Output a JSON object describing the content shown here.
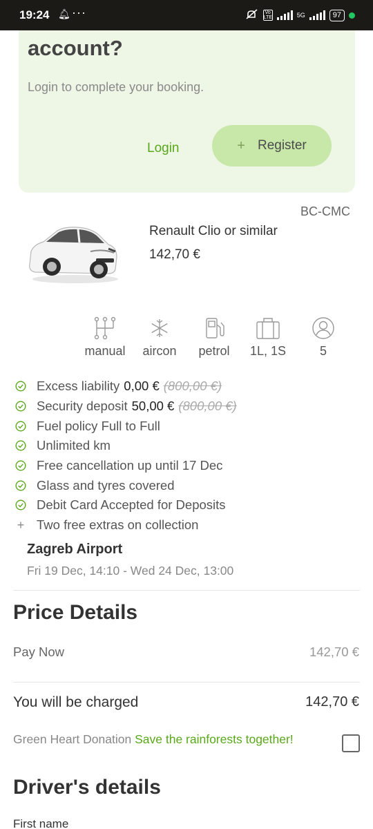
{
  "status_bar": {
    "time": "19:24",
    "network_labels": [
      "Vo LTE",
      "5G"
    ],
    "battery": "97",
    "icons": [
      "bell-icon",
      "more-icon",
      "mute-icon",
      "signal-icon",
      "battery-icon"
    ],
    "dot_color": "#22c55e"
  },
  "login_card": {
    "title": "account?",
    "subtitle": "Login to complete your booking.",
    "login_label": "Login",
    "register_label": "Register",
    "register_icon": "+",
    "bg_color": "#eef6e6",
    "accent": "#59a819"
  },
  "car": {
    "code": "BC-CMC",
    "name": "Renault Clio or similar",
    "price": "142,70 €",
    "image": "white-hatchback-car-image"
  },
  "features": [
    {
      "icon": "gearbox-icon",
      "label": "manual"
    },
    {
      "icon": "snowflake-icon",
      "label": "aircon"
    },
    {
      "icon": "fuel-pump-icon",
      "label": "petrol"
    },
    {
      "icon": "luggage-icon",
      "label": "1L, 1S"
    },
    {
      "icon": "person-icon",
      "label": "5"
    }
  ],
  "inclusions": [
    {
      "icon": "check-circle-icon",
      "text": "Excess liability",
      "value": "0,00 €",
      "old": "(800,00 €)"
    },
    {
      "icon": "check-circle-icon",
      "text": "Security deposit",
      "value": "50,00 €",
      "old": "(800,00 €)"
    },
    {
      "icon": "check-circle-icon",
      "text": "Fuel policy Full to Full"
    },
    {
      "icon": "check-circle-icon",
      "text": "Unlimited km"
    },
    {
      "icon": "check-circle-icon",
      "text": "Free cancellation up until 17 Dec"
    },
    {
      "icon": "check-circle-icon",
      "text": "Glass and tyres covered"
    },
    {
      "icon": "check-circle-icon",
      "text": "Debit Card Accepted for Deposits"
    },
    {
      "icon": "plus-icon",
      "text": "Two free extras on collection"
    }
  ],
  "trip": {
    "location": "Zagreb Airport",
    "dates": "Fri 19 Dec, 14:10 - Wed 24 Dec, 13:00"
  },
  "price_details": {
    "heading": "Price Details",
    "pay_now_label": "Pay Now",
    "pay_now_value": "142,70 €",
    "charged_label": "You will be charged",
    "charged_value": "142,70 €"
  },
  "donation": {
    "label": "Green Heart Donation",
    "link": "Save the rainforests together!",
    "checked": false
  },
  "drivers": {
    "heading": "Driver's details",
    "first_name_label": "First name"
  }
}
